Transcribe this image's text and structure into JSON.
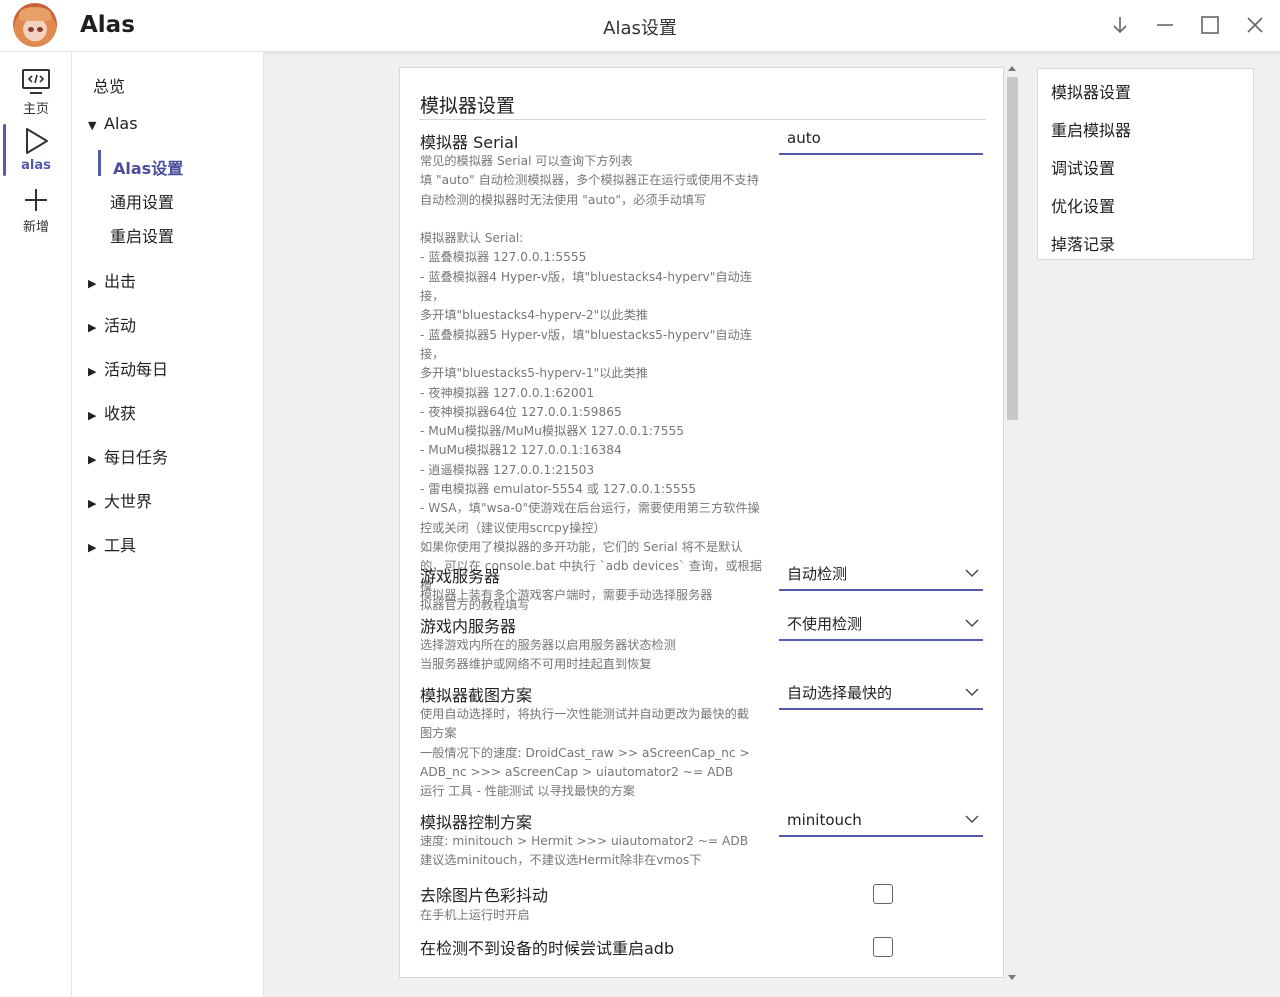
{
  "app": {
    "name": "Alas",
    "window_title": "Alas设置"
  },
  "window_controls": [
    "download-icon",
    "minimize-icon",
    "maximize-icon",
    "close-icon"
  ],
  "rail": [
    {
      "label": "主页",
      "icon": "code-monitor-icon"
    },
    {
      "label": "alas",
      "icon": "play-icon",
      "active": true
    },
    {
      "label": "新增",
      "icon": "plus-icon"
    }
  ],
  "nav": {
    "overview": "总览",
    "group": "Alas",
    "subs": [
      "Alas设置",
      "通用设置",
      "重启设置"
    ],
    "collapsed": [
      "出击",
      "活动",
      "活动每日",
      "收获",
      "每日任务",
      "大世界",
      "工具"
    ]
  },
  "panel": {
    "title": "模拟器设置",
    "options": [
      {
        "title": "模拟器 Serial",
        "help": "常见的模拟器 Serial 可以查询下方列表\n填 \"auto\" 自动检测模拟器，多个模拟器正在运行或使用不支持\n自动检测的模拟器时无法使用 \"auto\"，必须手动填写\n\n模拟器默认 Serial:\n- 蓝叠模拟器 127.0.0.1:5555\n- 蓝叠模拟器4 Hyper-v版，填\"bluestacks4-hyperv\"自动连接，\n多开填\"bluestacks4-hyperv-2\"以此类推\n- 蓝叠模拟器5 Hyper-v版，填\"bluestacks5-hyperv\"自动连接，\n多开填\"bluestacks5-hyperv-1\"以此类推\n- 夜神模拟器 127.0.0.1:62001\n- 夜神模拟器64位 127.0.0.1:59865\n- MuMu模拟器/MuMu模拟器X 127.0.0.1:7555\n- MuMu模拟器12 127.0.0.1:16384\n- 逍遥模拟器 127.0.0.1:21503\n- 雷电模拟器 emulator-5554 或 127.0.0.1:5555\n- WSA，填\"wsa-0\"使游戏在后台运行，需要使用第三方软件操\n控或关闭（建议使用scrcpy操控）\n如果你使用了模拟器的多开功能，它们的 Serial 将不是默认\n的，可以在 console.bat 中执行 `adb devices` 查询，或根据模\n拟器官方的教程填写",
        "value": "auto"
      },
      {
        "title": "游戏服务器",
        "help": "模拟器上装有多个游戏客户端时，需要手动选择服务器",
        "value": "自动检测"
      },
      {
        "title": "游戏内服务器",
        "help": "选择游戏内所在的服务器以启用服务器状态检测\n当服务器维护或网络不可用时挂起直到恢复",
        "value": "不使用检测"
      },
      {
        "title": "模拟器截图方案",
        "help": "使用自动选择时，将执行一次性能测试并自动更改为最快的截\n图方案\n一般情况下的速度: DroidCast_raw >> aScreenCap_nc >\nADB_nc >>> aScreenCap > uiautomator2 ~= ADB\n运行 工具 - 性能测试 以寻找最快的方案",
        "value": "自动选择最快的"
      },
      {
        "title": "模拟器控制方案",
        "help": "速度: minitouch > Hermit >>> uiautomator2 ~= ADB\n建议选minitouch，不建议选Hermit除非在vmos下",
        "value": "minitouch"
      },
      {
        "title": "去除图片色彩抖动",
        "help": "在手机上运行时开启",
        "checked": false
      },
      {
        "title": "在检测不到设备的时候尝试重启adb",
        "help": "",
        "checked": false
      }
    ]
  },
  "toc": [
    "模拟器设置",
    "重启模拟器",
    "调试设置",
    "优化设置",
    "掉落记录"
  ],
  "colors": {
    "accent": "#555aa8",
    "help_text": "#777777"
  }
}
